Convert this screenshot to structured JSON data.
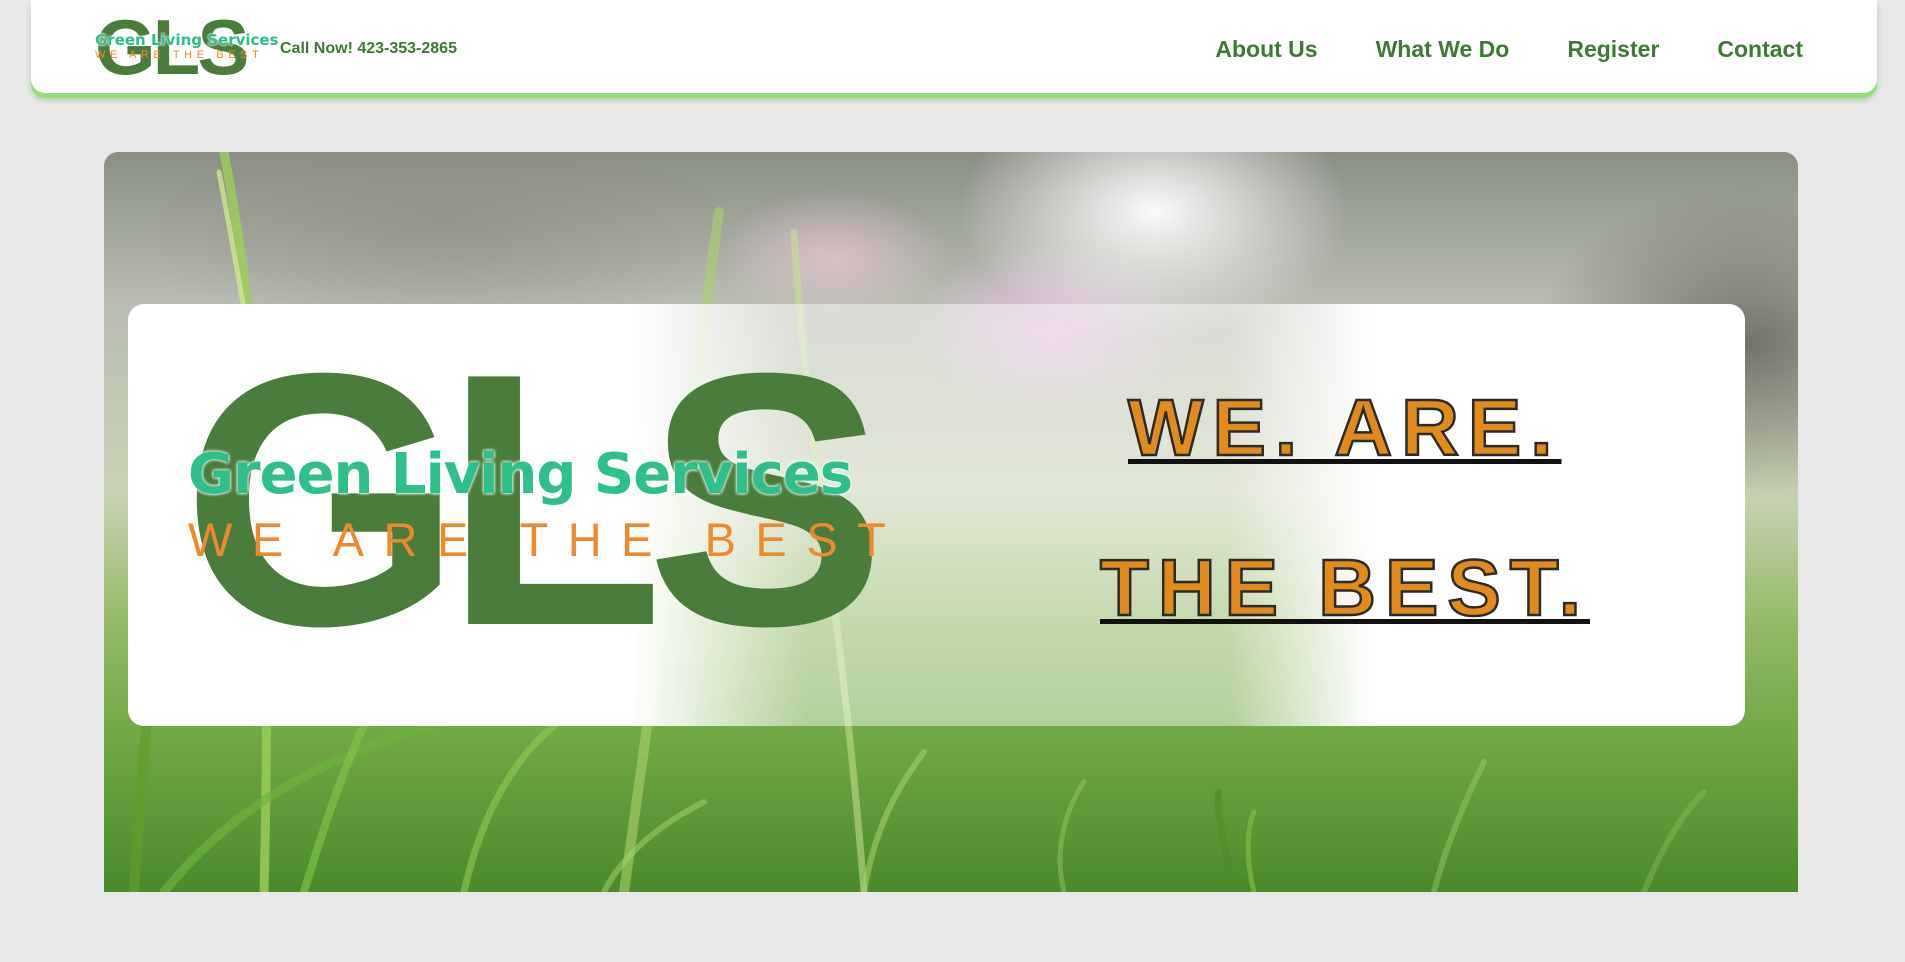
{
  "header": {
    "logo": {
      "letters": "GLS",
      "name": "Green Living Services",
      "tagline": "WE ARE THE BEST"
    },
    "phone": "Call Now! 423-353-2865",
    "nav": [
      {
        "label": "About Us"
      },
      {
        "label": "What We Do"
      },
      {
        "label": "Register"
      },
      {
        "label": "Contact"
      }
    ]
  },
  "hero": {
    "logo": {
      "letters": "GLS",
      "name": "Green Living Services",
      "tagline": "WE ARE THE BEST"
    },
    "slogan": {
      "line1": "WE. ARE.",
      "line2": "THE BEST."
    }
  },
  "colors": {
    "brand_dark_green": "#4a7d3c",
    "brand_teal": "#2fbf8a",
    "brand_orange": "#ee8a2e",
    "nav_green": "#3f7a35",
    "header_glow": "#8fe07a",
    "page_background": "#e8e8e8"
  }
}
